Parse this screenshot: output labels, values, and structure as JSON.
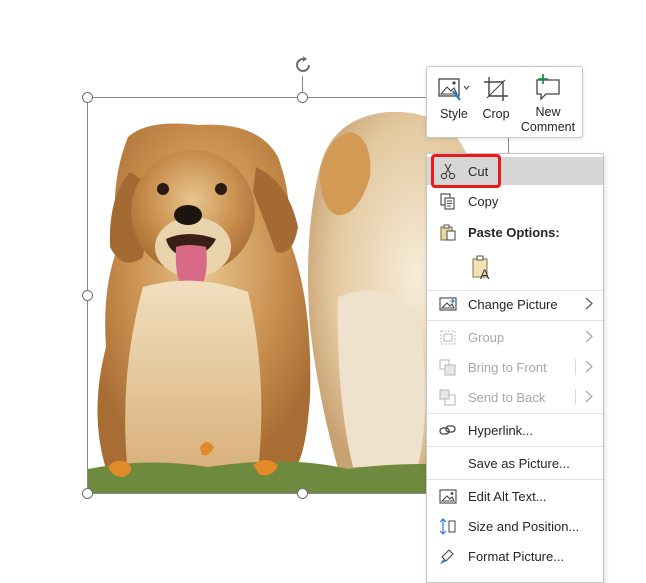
{
  "mini_toolbar": {
    "style_label": "Style",
    "crop_label": "Crop",
    "new_comment_label_line1": "New",
    "new_comment_label_line2": "Comment"
  },
  "context_menu": {
    "cut": "Cut",
    "copy": "Copy",
    "paste_options": "Paste Options:",
    "change_picture": "Change Picture",
    "group": "Group",
    "bring_to_front": "Bring to Front",
    "send_to_back": "Send to Back",
    "hyperlink": "Hyperlink...",
    "save_as_picture": "Save as Picture...",
    "edit_alt_text": "Edit Alt Text...",
    "size_and_position": "Size and Position...",
    "format_picture": "Format Picture..."
  },
  "colors": {
    "highlight_border": "#e81a1a",
    "hover_background": "#d6d6d6",
    "disabled_text": "#a6a6a6",
    "icon_blue": "#2b7cd3",
    "icon_green": "#1e8f4e"
  },
  "icons": {
    "style": "picture-style-icon",
    "crop": "crop-icon",
    "new_comment": "new-comment-icon",
    "cut": "scissors-icon",
    "copy": "copy-icon",
    "paste": "clipboard-icon",
    "paste_text_only": "paste-text-only-icon",
    "change_picture": "change-picture-icon",
    "group": "group-icon",
    "bring_to_front": "bring-to-front-icon",
    "send_to_back": "send-to-back-icon",
    "hyperlink": "link-icon",
    "edit_alt_text": "alt-text-icon",
    "size_and_position": "size-position-icon",
    "format_picture": "format-picture-icon"
  }
}
